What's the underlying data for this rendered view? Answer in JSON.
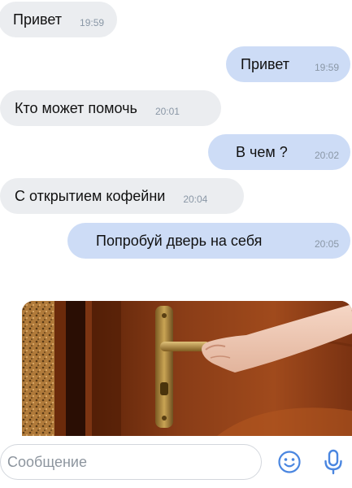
{
  "messages": [
    {
      "direction": "in",
      "text": "Привет",
      "time": "19:59"
    },
    {
      "direction": "out",
      "text": "Привет",
      "time": "19:59"
    },
    {
      "direction": "in",
      "text": "Кто может помочь",
      "time": "20:01"
    },
    {
      "direction": "out",
      "text": "В чем ?",
      "time": "20:02"
    },
    {
      "direction": "in",
      "text": "С открытием кофейни",
      "time": "20:04"
    },
    {
      "direction": "out",
      "text": "Попробуй дверь на себя",
      "time": "20:05"
    }
  ],
  "attachment": {
    "type": "image",
    "subject": "hand-opening-door"
  },
  "composer": {
    "placeholder": "Сообщение",
    "emoji_icon": "smiley-icon",
    "voice_icon": "microphone-icon",
    "accent_color": "#4a86e0"
  },
  "colors": {
    "incoming_bubble": "#ebedf0",
    "outgoing_bubble": "#cddcf6",
    "timestamp": "#8a97a6"
  }
}
